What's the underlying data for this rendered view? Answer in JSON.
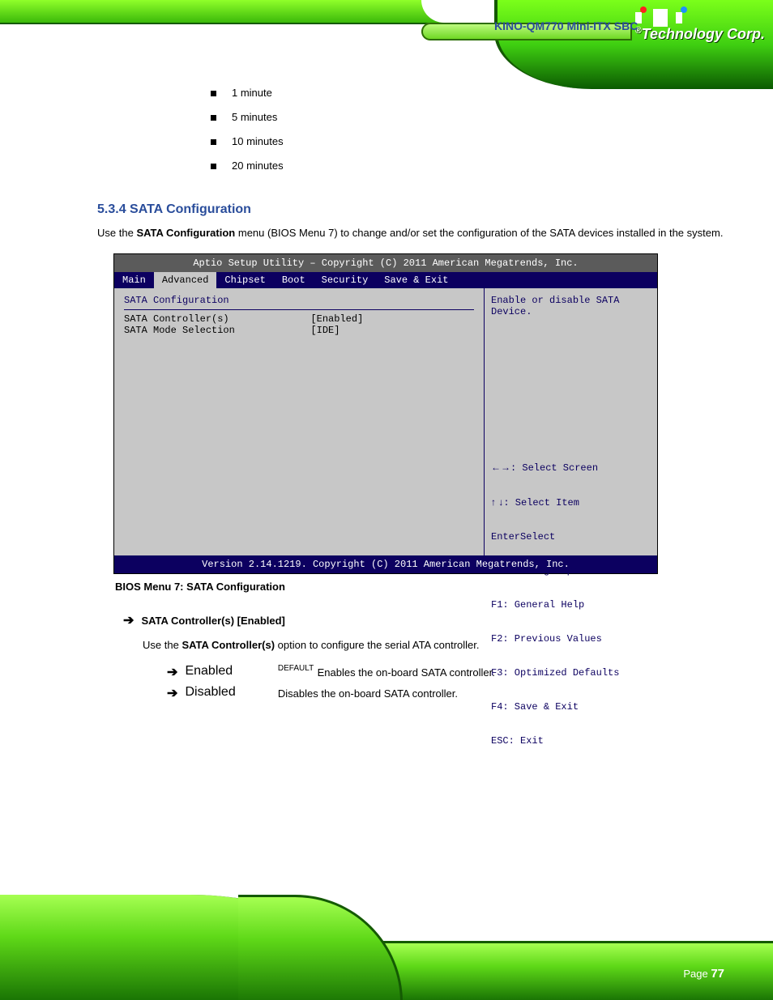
{
  "doc": {
    "title": "KINO-QM770 Mini-ITX SBC"
  },
  "logo": {
    "corp": "Technology Corp.",
    "reg": "®"
  },
  "squares": [
    "1 minute",
    "5 minutes",
    "10 minutes",
    "20 minutes"
  ],
  "section": {
    "heading": "5.3.4 SATA Configuration",
    "intro_label": "Use the",
    "intro_name": "SATA Configuration",
    "intro_rest": "menu (BIOS Menu 7) to change and/or set the configuration of the SATA devices installed in the system."
  },
  "bios": {
    "top_title": "Aptio Setup Utility – Copyright (C) 2011 American Megatrends, Inc.",
    "tabs": [
      "Main",
      "Advanced",
      "Chipset",
      "Boot",
      "Security",
      "Save & Exit"
    ],
    "active_tab_index": 1,
    "config_title": "SATA Configuration",
    "lines": [
      {
        "k": "SATA Controller(s)",
        "v": "[Enabled]"
      },
      {
        "k": "SATA Mode Selection",
        "v": "[IDE]"
      }
    ],
    "tip1": "Enable or disable SATA",
    "tip2": "Device.",
    "nav": [
      {
        "sym": "←→",
        "txt": ": Select Screen"
      },
      {
        "sym": "↑ ↓",
        "txt": ": Select Item"
      },
      {
        "sym": "Enter",
        "txt": "Select"
      },
      {
        "sym": "+/-",
        "txt": ": Change Opt."
      },
      {
        "sym": "F1",
        "txt": ": General Help"
      },
      {
        "sym": "F2",
        "txt": ": Previous Values"
      },
      {
        "sym": "F3",
        "txt": ": Optimized Defaults"
      },
      {
        "sym": "F4",
        "txt": ": Save & Exit"
      },
      {
        "sym": "ESC",
        "txt": ": Exit"
      }
    ],
    "foot": "Version 2.14.1219. Copyright (C) 2011 American Megatrends, Inc.",
    "caption": "BIOS Menu 7: SATA Configuration"
  },
  "option": {
    "title": "SATA Controller(s) [Enabled]",
    "desc_pre": "Use the",
    "desc_name": "SATA Controller(s)",
    "desc_rest": "option to configure the serial ATA controller.",
    "choices": [
      {
        "val": "Enabled",
        "def": "DEFAULT",
        "expl": "Enables the on-board SATA controller."
      },
      {
        "val": "Disabled",
        "def": "",
        "expl": "Disables the on-board SATA controller."
      }
    ]
  },
  "page_label": "Page",
  "page_number": "77"
}
